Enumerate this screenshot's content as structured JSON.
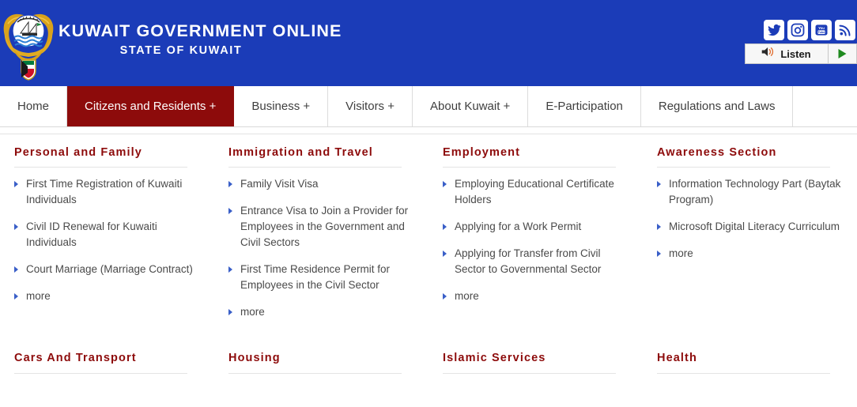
{
  "header": {
    "title": "KUWAIT GOVERNMENT ONLINE",
    "subtitle": "STATE OF KUWAIT",
    "emblem_name": "kuwait-state-emblem",
    "bg_color": "#1b3cb8",
    "social": [
      {
        "name": "twitter-icon",
        "label": "Twitter"
      },
      {
        "name": "instagram-icon",
        "label": "Instagram"
      },
      {
        "name": "youtube-icon",
        "label": "YouTube"
      },
      {
        "name": "rss-icon",
        "label": "RSS"
      }
    ],
    "listen": {
      "label": "Listen",
      "speaker_icon": "speaker-icon",
      "play_icon": "play-triangle-icon"
    }
  },
  "nav": {
    "active_color": "#8d0b0b",
    "items": [
      {
        "label": "Home",
        "active": false
      },
      {
        "label": "Citizens and Residents +",
        "active": true
      },
      {
        "label": "Business +",
        "active": false
      },
      {
        "label": "Visitors +",
        "active": false
      },
      {
        "label": "About Kuwait +",
        "active": false
      },
      {
        "label": "E-Participation",
        "active": false
      },
      {
        "label": "Regulations and Laws",
        "active": false
      }
    ]
  },
  "megamenu": {
    "heading_color": "#8d0b0b",
    "row1": [
      {
        "heading": "Personal and Family",
        "items": [
          "First Time Registration of Kuwaiti Individuals",
          "Civil ID Renewal for Kuwaiti Individuals",
          "Court Marriage (Marriage Contract)",
          "more"
        ]
      },
      {
        "heading": "Immigration and Travel",
        "items": [
          "Family Visit Visa",
          "Entrance Visa to Join a Provider for Employees in the Government and Civil Sectors",
          "First Time Residence Permit for Employees in the Civil Sector",
          "more"
        ]
      },
      {
        "heading": "Employment",
        "items": [
          "Employing Educational Certificate Holders",
          "Applying for a Work Permit",
          "Applying for Transfer from Civil Sector to Governmental Sector",
          "more"
        ]
      },
      {
        "heading": "Awareness Section",
        "items": [
          "Information Technology Part (Baytak Program)",
          "Microsoft Digital Literacy Curriculum",
          "more"
        ]
      }
    ],
    "row2": [
      {
        "heading": "Cars And Transport"
      },
      {
        "heading": "Housing"
      },
      {
        "heading": "Islamic Services"
      },
      {
        "heading": "Health"
      }
    ]
  }
}
